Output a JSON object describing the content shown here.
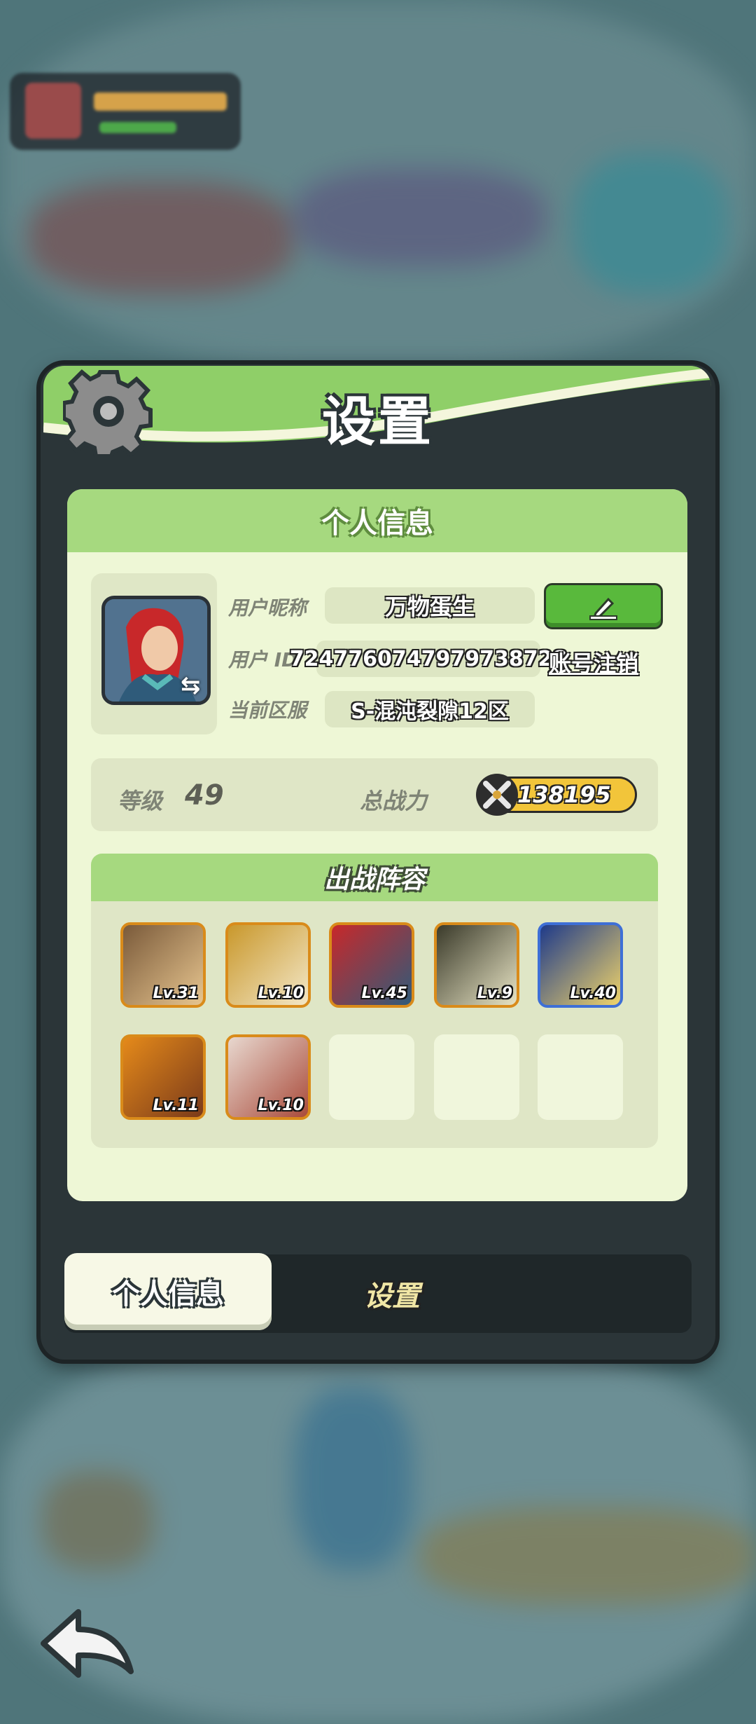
{
  "dialog": {
    "title": "设置",
    "section_title": "个人信息"
  },
  "profile": {
    "nickname_label": "用户昵称",
    "nickname_value": "万物蛋生",
    "user_id_label": "用户 ID",
    "user_id_value": "7247760747979738728",
    "logout_link": "账号注销",
    "server_label": "当前区服",
    "server_value": "S-混沌裂隙12区",
    "edit_icon": "pencil-icon"
  },
  "stats": {
    "level_label": "等级",
    "level_value": "49",
    "power_label": "总战力",
    "power_value": "138195"
  },
  "team": {
    "title": "出战阵容",
    "heroes": [
      {
        "level": "Lv.31"
      },
      {
        "level": "Lv.10"
      },
      {
        "level": "Lv.45"
      },
      {
        "level": "Lv.9"
      },
      {
        "level": "Lv.40"
      },
      {
        "level": "Lv.11"
      },
      {
        "level": "Lv.10"
      }
    ]
  },
  "tabs": {
    "personal": "个人信息",
    "settings": "设置"
  },
  "colors": {
    "accent_green": "#a6d97f",
    "panel_dark": "#2b3538",
    "power_gold": "#f2c53a"
  }
}
